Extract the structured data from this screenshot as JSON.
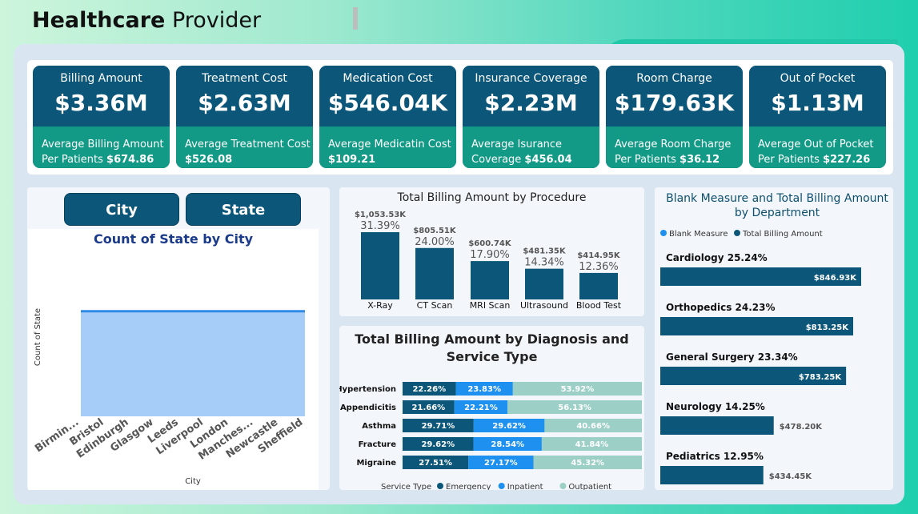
{
  "header": {
    "title_bold": "Healthcare",
    "title_rest": " Provider"
  },
  "kpis": [
    {
      "label": "Billing Amount",
      "value": "$3.36M",
      "sub_line1": "Average Billing Amount",
      "sub_prefix": "Per Patients ",
      "sub_value": "$674.86"
    },
    {
      "label": "Treatment Cost",
      "value": "$2.63M",
      "sub_line1": "Average Treatment Cost",
      "sub_prefix": "",
      "sub_value": "$526.08"
    },
    {
      "label": "Medication Cost",
      "value": "$546.04K",
      "sub_line1": "Average Medicatin Cost",
      "sub_prefix": "",
      "sub_value": "$109.21"
    },
    {
      "label": "Insurance Coverage",
      "value": "$2.23M",
      "sub_line1": "Average Isurance",
      "sub_prefix": "Coverage ",
      "sub_value": "$456.04"
    },
    {
      "label": "Room Charge",
      "value": "$179.63K",
      "sub_line1": "Average Room Charge",
      "sub_prefix": "Per Patients ",
      "sub_value": "$36.12"
    },
    {
      "label": "Out of Pocket",
      "value": "$1.13M",
      "sub_line1": "Average Out of Pocket",
      "sub_prefix": "Per Patients ",
      "sub_value": "$227.26"
    }
  ],
  "slicers": {
    "city_label": "City",
    "state_label": "State"
  },
  "colors": {
    "primary": "#0c5779",
    "teal": "#139a86",
    "inpatient": "#1e90f0",
    "outpatient": "#9ccfc6",
    "area": "#a6cdf7",
    "line": "#2f8be6"
  },
  "chart_data": [
    {
      "type": "area",
      "title": "Count of State by City",
      "xlabel": "City",
      "ylabel": "Count of State",
      "categories": [
        "Birmin...",
        "Bristol",
        "Edinburgh",
        "Glasgow",
        "Leeds",
        "Liverpool",
        "London",
        "Manches...",
        "Newcastle",
        "Sheffield"
      ],
      "values": [
        1,
        1,
        1,
        1,
        1,
        1,
        1,
        1,
        1,
        1
      ],
      "ylim": [
        0,
        1.6
      ]
    },
    {
      "type": "bar",
      "title": "Total Billing Amount by Procedure",
      "categories": [
        "X-Ray",
        "CT Scan",
        "MRI Scan",
        "Ultrasound",
        "Blood Test"
      ],
      "values": [
        1053.53,
        805.51,
        600.74,
        481.35,
        414.95
      ],
      "value_labels": [
        "$1,053.53K",
        "$805.51K",
        "$600.74K",
        "$481.35K",
        "$414.95K"
      ],
      "percent_labels": [
        "31.39%",
        "24.00%",
        "17.90%",
        "14.34%",
        "12.36%"
      ]
    },
    {
      "type": "bar",
      "title": "Total Billing Amount by Diagnosis and Service Type",
      "categories": [
        "Hypertension",
        "Appendicitis",
        "Asthma",
        "Fracture",
        "Migraine"
      ],
      "series": [
        {
          "name": "Emergency",
          "values": [
            22.26,
            21.66,
            29.71,
            29.62,
            27.51
          ],
          "labels": [
            "22.26%",
            "21.66%",
            "29.71%",
            "29.62%",
            "27.51%"
          ]
        },
        {
          "name": "Inpatient",
          "values": [
            23.83,
            22.21,
            29.62,
            28.54,
            27.17
          ],
          "labels": [
            "23.83%",
            "22.21%",
            "29.62%",
            "28.54%",
            "27.17%"
          ]
        },
        {
          "name": "Outpatient",
          "values": [
            53.92,
            56.13,
            40.66,
            41.84,
            45.32
          ],
          "labels": [
            "53.92%",
            "56.13%",
            "40.66%",
            "41.84%",
            "45.32%"
          ]
        }
      ],
      "legend_title": "Service Type",
      "legend": "bottom"
    },
    {
      "type": "bar",
      "title": "Blank Measure and Total Billing Amount by Department",
      "legend_items": [
        "Blank Measure",
        "Total Billing Amount"
      ],
      "legend": "top",
      "categories": [
        "Cardiology",
        "Orthopedics",
        "General Surgery",
        "Neurology",
        "Pediatrics"
      ],
      "category_labels": [
        "Cardiology 25.24%",
        "Orthopedics 24.23%",
        "General Surgery 23.34%",
        "Neurology 14.25%",
        "Pediatrics 12.95%"
      ],
      "values": [
        846.93,
        813.25,
        783.25,
        478.2,
        434.45
      ],
      "value_labels": [
        "$846.93K",
        "$813.25K",
        "$783.25K",
        "$478.20K",
        "$434.45K"
      ]
    }
  ]
}
